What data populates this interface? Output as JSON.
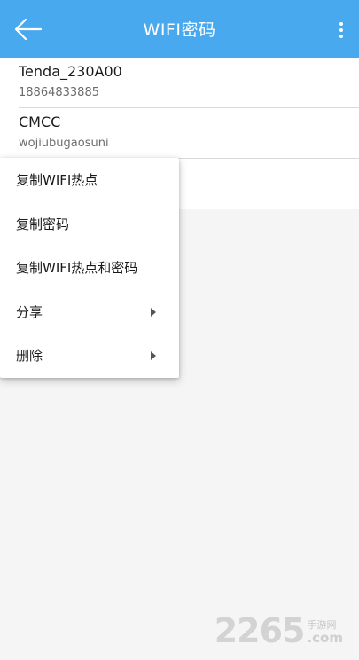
{
  "appbar": {
    "title": "WIFI密码",
    "back_icon": "arrow-left-icon",
    "more_icon": "more-vert-icon",
    "color": "#48a9ef"
  },
  "networks": [
    {
      "ssid": "Tenda_230A00",
      "password": "18864833885"
    },
    {
      "ssid": "CMCC",
      "password": "wojiubugaosuni"
    }
  ],
  "context_menu": {
    "items": [
      {
        "label": "复制WIFI热点",
        "has_submenu": false
      },
      {
        "label": "复制密码",
        "has_submenu": false
      },
      {
        "label": "复制WIFI热点和密码",
        "has_submenu": false
      },
      {
        "label": "分享",
        "has_submenu": true
      },
      {
        "label": "删除",
        "has_submenu": true
      }
    ]
  },
  "watermark": {
    "number": "2265",
    "site_cn": "手游网",
    "site_en": ".com"
  }
}
